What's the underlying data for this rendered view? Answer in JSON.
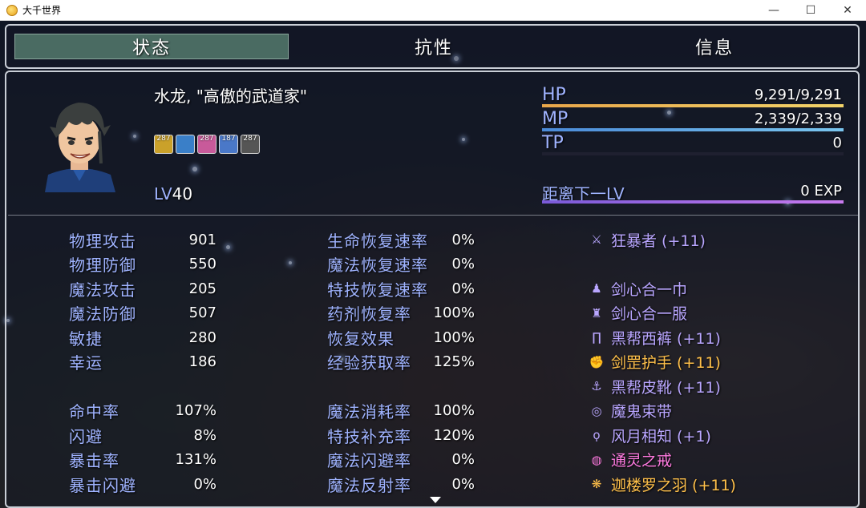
{
  "window": {
    "title": "大千世界"
  },
  "tabs": [
    {
      "label": "状态",
      "active": true
    },
    {
      "label": "抗性",
      "active": false
    },
    {
      "label": "信息",
      "active": false
    }
  ],
  "character": {
    "name": "水龙, \"高傲的武道家\"",
    "level_label": "LV",
    "level": "40",
    "states": [
      {
        "icon": "dagger-up-icon",
        "count": "287",
        "color": "#caa12a"
      },
      {
        "icon": "dragon-icon",
        "count": "",
        "color": "#3a7fc8"
      },
      {
        "icon": "pink-buff-icon",
        "count": "287",
        "color": "#c85a9a"
      },
      {
        "icon": "blue-buff-icon",
        "count": "187",
        "color": "#4a78c8"
      },
      {
        "icon": "skull-icon",
        "count": "287",
        "color": "#555"
      }
    ]
  },
  "gauges": {
    "hp": {
      "label": "HP",
      "value": "9,291/9,291",
      "fraction": 1.0,
      "color_a": "#e8a64a",
      "color_b": "#f2d46a"
    },
    "mp": {
      "label": "MP",
      "value": "2,339/2,339",
      "fraction": 1.0,
      "color_a": "#4a8ad8",
      "color_b": "#7ac6ef"
    },
    "tp": {
      "label": "TP",
      "value": "0",
      "fraction": 0.0,
      "color_a": "#4a9a5a",
      "color_b": "#7ad87a"
    },
    "exp": {
      "label": "距离下一LV",
      "value": "0 EXP",
      "fraction": 1.0,
      "color_a": "#7a5ad8",
      "color_b": "#c87aef"
    }
  },
  "params_left": [
    {
      "label": "物理攻击",
      "value": "901"
    },
    {
      "label": "物理防御",
      "value": "550"
    },
    {
      "label": "魔法攻击",
      "value": "205"
    },
    {
      "label": "魔法防御",
      "value": "507"
    },
    {
      "label": "敏捷",
      "value": "280"
    },
    {
      "label": "幸运",
      "value": "186"
    },
    {
      "label": "",
      "value": ""
    },
    {
      "label": "命中率",
      "value": "107%"
    },
    {
      "label": "闪避",
      "value": "8%"
    },
    {
      "label": "暴击率",
      "value": "131%"
    },
    {
      "label": "暴击闪避",
      "value": "0%"
    }
  ],
  "params_right": [
    {
      "label": "生命恢复速率",
      "value": "0%"
    },
    {
      "label": "魔法恢复速率",
      "value": "0%"
    },
    {
      "label": "特技恢复速率",
      "value": "0%"
    },
    {
      "label": "药剂恢复率",
      "value": "100%"
    },
    {
      "label": "恢复效果",
      "value": "100%"
    },
    {
      "label": "经验获取率",
      "value": "125%"
    },
    {
      "label": "",
      "value": ""
    },
    {
      "label": "魔法消耗率",
      "value": "100%"
    },
    {
      "label": "特技补充率",
      "value": "120%"
    },
    {
      "label": "魔法闪避率",
      "value": "0%"
    },
    {
      "label": "魔法反射率",
      "value": "0%"
    }
  ],
  "equipment": [
    {
      "icon": "sword-icon",
      "glyph": "⚔",
      "name": "狂暴者 (+11)",
      "color": "#b9a6ff"
    },
    {
      "icon": "",
      "glyph": "",
      "name": "",
      "color": "#fff"
    },
    {
      "icon": "headband-icon",
      "glyph": "♟",
      "name": "剑心合一巾",
      "color": "#b9a6ff"
    },
    {
      "icon": "robe-icon",
      "glyph": "♜",
      "name": "剑心合一服",
      "color": "#b9a6ff"
    },
    {
      "icon": "pants-icon",
      "glyph": "∏",
      "name": "黑帮西裤 (+11)",
      "color": "#b9a6ff"
    },
    {
      "icon": "gauntlet-icon",
      "glyph": "✊",
      "name": "剑罡护手 (+11)",
      "color": "#ffc04a"
    },
    {
      "icon": "boots-icon",
      "glyph": "⚓",
      "name": "黑帮皮靴 (+11)",
      "color": "#b9a6ff"
    },
    {
      "icon": "belt-icon",
      "glyph": "◎",
      "name": "魔鬼束带",
      "color": "#b9a6ff"
    },
    {
      "icon": "necklace-icon",
      "glyph": "ϙ",
      "name": "风月相知 (+1)",
      "color": "#b9a6ff"
    },
    {
      "icon": "ring-icon",
      "glyph": "◍",
      "name": "通灵之戒",
      "color": "#ff7ae0"
    },
    {
      "icon": "feather-icon",
      "glyph": "❋",
      "name": "迦楼罗之羽 (+11)",
      "color": "#ffc04a"
    }
  ]
}
